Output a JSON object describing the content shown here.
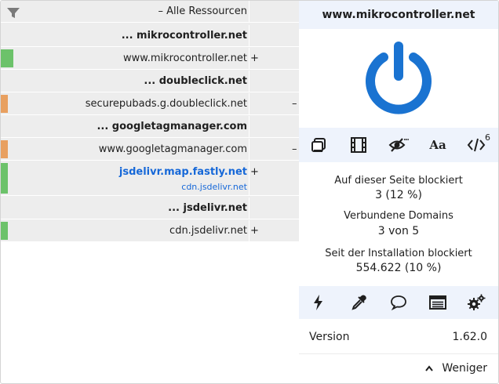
{
  "firewall": {
    "all_resources": "– Alle Ressourcen",
    "rows": [
      {
        "name": "... mikrocontroller.net",
        "bold": true
      },
      {
        "name": "www.mikrocontroller.net",
        "action": "+"
      },
      {
        "name": "... doubleclick.net",
        "bold": true
      },
      {
        "name": "securepubads.g.doubleclick.net",
        "action": "–"
      },
      {
        "name": "... googletagmanager.com",
        "bold": true
      },
      {
        "name": "www.googletagmanager.com",
        "action": "–"
      },
      {
        "name": "jsdelivr.map.fastly.net",
        "sub": "cdn.jsdelivr.net",
        "action": "+"
      },
      {
        "name": "... jsdelivr.net",
        "bold": true
      },
      {
        "name": "cdn.jsdelivr.net",
        "action": "+"
      }
    ]
  },
  "panel": {
    "hostname": "www.mikrocontroller.net",
    "tools_badge": "6",
    "tool_font_label": "Aa",
    "stats": {
      "blocked_label": "Auf dieser Seite blockiert",
      "blocked_value": "3 (12 %)",
      "domains_label": "Verbundene Domains",
      "domains_value": "3 von 5",
      "since_label": "Seit der Installation blockiert",
      "since_value": "554.622 (10 %)"
    },
    "version_label": "Version",
    "version_value": "1.62.0",
    "less_label": "Weniger"
  },
  "colors": {
    "accent": "#1a73d1",
    "green": "#6cc26a",
    "orange": "#e8a060",
    "panel_bg": "#eef3fc",
    "row_bg": "#ededed"
  }
}
